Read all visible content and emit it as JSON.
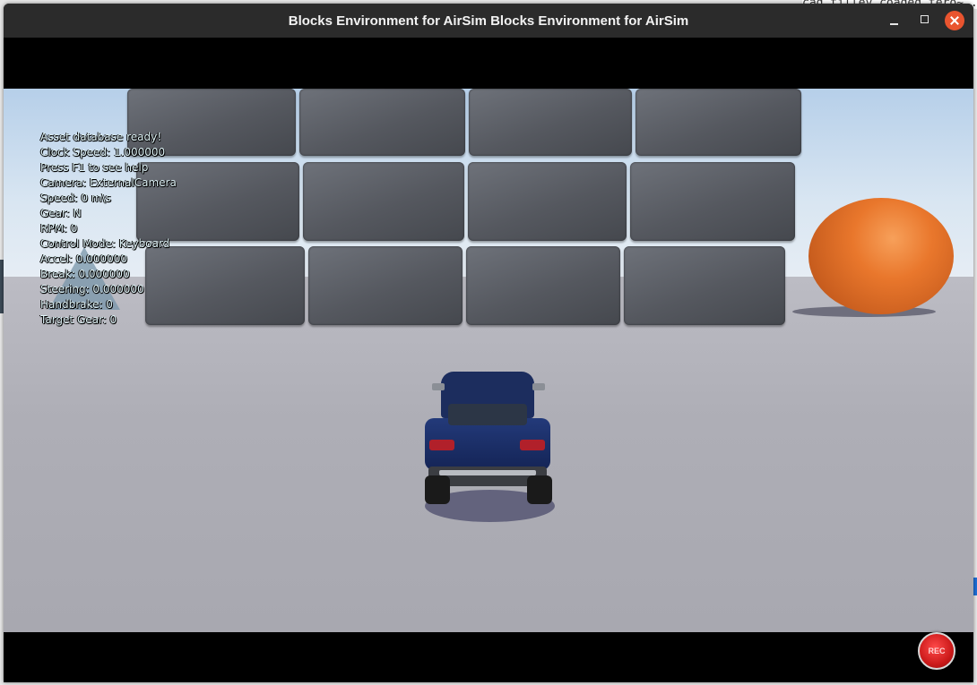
{
  "window": {
    "title": "Blocks Environment for AirSim Blocks Environment for AirSim"
  },
  "background": {
    "terminal_fragment": "cad_tilley  coaded  tero~  ..., ..., ..., ..., ..., ..., Robotsolvais"
  },
  "hud": {
    "lines": [
      "Asset database ready!",
      "Clock Speed: 1.000000",
      "Press F1 to see help",
      "Camera: ExternalCamera",
      "Speed: 0 m\\s",
      "Gear: N",
      "RPM: 0",
      "Control Mode: Keyboard",
      "Accel: 0.000000",
      "Break: 0.000000",
      "Steering: 0.000000",
      "Handbrake: 0",
      "Target Gear: 0"
    ]
  },
  "record": {
    "label": "REC"
  },
  "colors": {
    "titlebar": "#2b2b2b",
    "close_button": "#e9542f",
    "hud_text": "#dff3f7",
    "record_button": "#cc1a1a"
  }
}
